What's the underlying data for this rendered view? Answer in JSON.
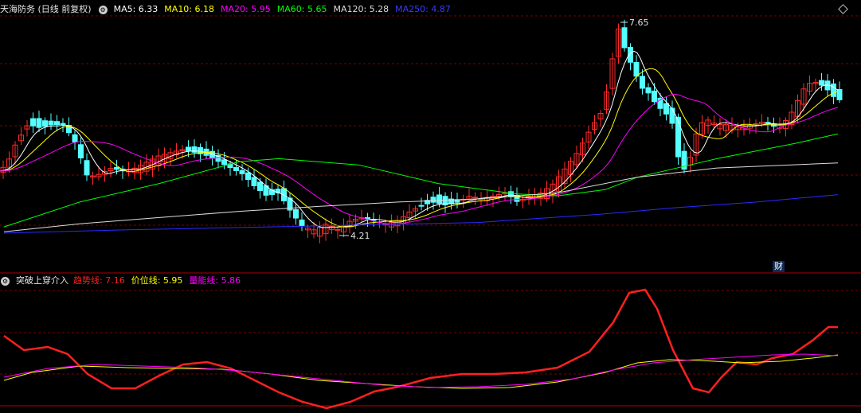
{
  "main_panel": {
    "title": "天海防务 (日线 前复权)",
    "ma": [
      {
        "label": "MA5: 6.33",
        "color": "#ffffff"
      },
      {
        "label": "MA10: 6.18",
        "color": "#ffff00"
      },
      {
        "label": "MA20: 5.95",
        "color": "#ff00ff"
      },
      {
        "label": "MA60: 5.65",
        "color": "#00ff00"
      },
      {
        "label": "MA120: 5.28",
        "color": "#dcdcdc"
      },
      {
        "label": "MA250: 4.87",
        "color": "#0000ff"
      }
    ],
    "high_label": "7.65",
    "low_label": "4.21",
    "finance_badge": "财"
  },
  "indicator_panel": {
    "title": "突破上穿介入",
    "lines": [
      {
        "label": "趋势线: 7.16",
        "color": "#ff2020"
      },
      {
        "label": "价位线: 5.95",
        "color": "#ffff00"
      },
      {
        "label": "量能线: 5.86",
        "color": "#ff00ff"
      }
    ]
  },
  "colors": {
    "up": "#ff2a2a",
    "down": "#54ffff",
    "grid": "#7a0000",
    "bg": "#000000"
  }
}
